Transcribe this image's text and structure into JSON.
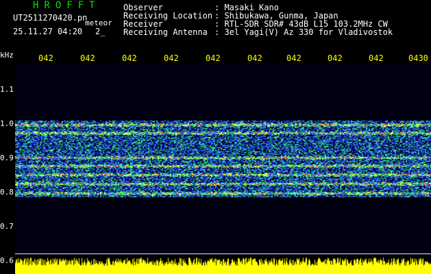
{
  "header": {
    "brand": "HROFFT",
    "filename": "UT2511270420.pn",
    "meteor_label": "meteor",
    "datetime": "25.11.27 04:20",
    "datetime_extra": "2_",
    "observer_label": "Observer",
    "observer_value": ": Masaki Kano",
    "location_label": "Receiving Location",
    "location_value": ": Shibukawa, Gunma, Japan",
    "receiver_label": "Receiver",
    "receiver_value": ": RTL-SDR SDR# 43dB L15 103.2MHz CW",
    "antenna_label": "Receiving Antenna",
    "antenna_value": ": 3el Yagi(V) Az 330 for Vladivostok"
  },
  "axes": {
    "y_unit": "kHz",
    "y_ticks": [
      "1.1",
      "1.0",
      "0.9",
      "0.8",
      "0.7",
      "0.6"
    ],
    "x_ticks": [
      "042",
      "042",
      "042",
      "042",
      "042",
      "042",
      "042",
      "042",
      "042",
      "0430"
    ]
  },
  "colors": {
    "brand": "#00e000",
    "tick_labels": "#ffff00",
    "bottom_trace": "#ffff00",
    "spectrogram_bg": "#000010"
  }
}
